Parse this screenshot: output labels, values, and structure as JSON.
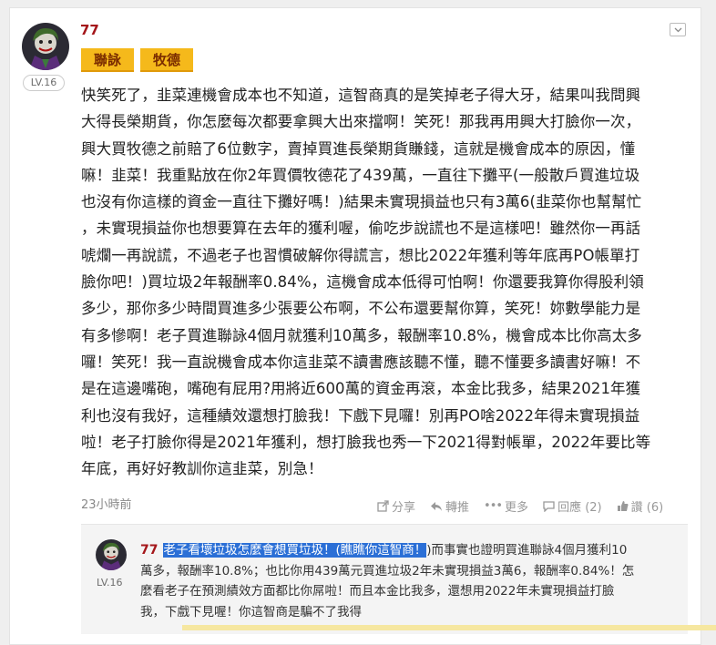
{
  "post": {
    "author": "77",
    "level": "LV.16",
    "tags": [
      "聯詠",
      "牧德"
    ],
    "body_lines": [
      "快笑死了，韭菜連機會成本也不知道，這智商真的是笑掉老子得大牙，結果叫我問興",
      "大得長榮期貨，你怎麼每次都要拿興大出來擋啊！笑死！那我再用興大打臉你一次，",
      "興大買牧德之前賠了6位數字，賣掉買進長榮期貨賺錢，這就是機會成本的原因，懂",
      "嘛！韭菜！我重點放在你2年買價牧德花了439萬，一直往下攤平(一般散戶買進垃圾",
      "也沒有你這樣的資金一直往下攤好嗎！)結果未實現損益也只有3萬6(韭菜你也幫幫忙",
      "，未實現損益你也想要算在去年的獲利喔，偷吃步說謊也不是這樣吧！雖然你一再話",
      "唬爛一再說謊，不過老子也習慣破解你得謊言，想比2022年獲利等年底再PO帳單打",
      "臉你吧！)買垃圾2年報酬率0.84%，這機會成本低得可怕啊！你還要我算你得股利領",
      "多少，那你多少時間買進多少張要公布啊，不公布還要幫你算，笑死！妳數學能力是",
      "有多慘啊！老子買進聯詠4個月就獲利10萬多，報酬率10.8%，機會成本比你高太多",
      "囉！笑死！我一直說機會成本你這韭菜不讀書應該聽不懂，聽不懂要多讀書好嘛！不",
      "是在這邊嘴砲，嘴砲有屁用?用將近600萬的資金再滾，本金比我多，結果2021年獲",
      "利也沒有我好，這種績效還想打臉我！下戲下見囉！別再PO啥2022年得未實現損益",
      "啦！老子打臉你得是2021年獲利，想打臉我也秀一下2021得對帳單，2022年要比等",
      "年底，再好好教訓你這韭菜，別急！"
    ],
    "time": "23小時前",
    "actions": {
      "share": "分享",
      "repost": "轉推",
      "more": "更多",
      "reply": "回應 (2)",
      "like": "讚 (6)"
    }
  },
  "reply": {
    "author": "77",
    "level": "LV.16",
    "highlighted": "老子看壞垃圾怎麼會想買垃圾！(瞧瞧你這智商！",
    "line1_rest": ")而事實也證明買進聯詠4個月獲利10",
    "lines": [
      "萬多，報酬率10.8%；也比你用439萬元買進垃圾2年未實現損益3萬6，報酬率0.84%！怎",
      "麼看老子在預測績效方面都比你屌啦！而且本金比我多，還想用2022年未實現損益打臉",
      "我，下戲下見喔！你這智商是騙不了我得"
    ]
  },
  "colors": {
    "author": "#a4161a",
    "tag_bg": "#f5b91b",
    "highlight": "#2b6fd6"
  }
}
